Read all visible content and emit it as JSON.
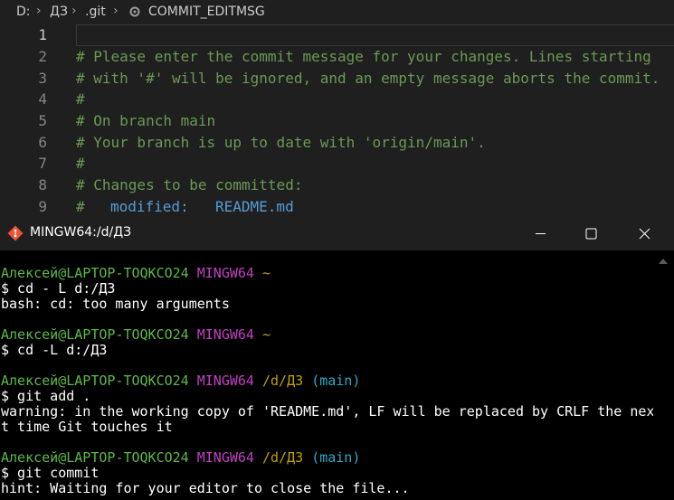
{
  "breadcrumb": {
    "drive": "D:",
    "folder1": "ДЗ",
    "folder2": ".git",
    "file": "COMMIT_EDITMSG"
  },
  "editor": {
    "lines": [
      {
        "num": "1",
        "text": ""
      },
      {
        "num": "2",
        "text": "# Please enter the commit message for your changes. Lines starting"
      },
      {
        "num": "3",
        "text": "# with '#' will be ignored, and an empty message aborts the commit."
      },
      {
        "num": "4",
        "text": "#"
      },
      {
        "num": "5",
        "text": "# On branch main"
      },
      {
        "num": "6",
        "text": "# Your branch is up to date with 'origin/main'."
      },
      {
        "num": "7",
        "text": "#"
      },
      {
        "num": "8",
        "text": "# Changes to be committed:"
      },
      {
        "num": "9",
        "prefix": "#",
        "label": "modified:",
        "file": "README.md"
      }
    ]
  },
  "terminal": {
    "title": "MINGW64:/d/ДЗ",
    "prompts": [
      {
        "user": "Алексей@LAPTOP-TOQKCO24",
        "env": "MINGW64",
        "path": "~",
        "branch": ""
      },
      {
        "user": "Алексей@LAPTOP-TOQKCO24",
        "env": "MINGW64",
        "path": "~",
        "branch": ""
      },
      {
        "user": "Алексей@LAPTOP-TOQKCO24",
        "env": "MINGW64",
        "path": "/d/ДЗ",
        "branch": "(main)"
      },
      {
        "user": "Алексей@LAPTOP-TOQKCO24",
        "env": "MINGW64",
        "path": "/d/ДЗ",
        "branch": "(main)"
      }
    ],
    "commands": [
      "$ cd - L d:/ДЗ",
      "$ cd -L d:/ДЗ",
      "$ git add .",
      "$ git commit"
    ],
    "outputs": {
      "cd_error": "bash: cd: too many arguments",
      "warning_1": "warning: in the working copy of 'README.md', LF will be replaced by CRLF the nex",
      "warning_2": "t time Git touches it",
      "hint": "hint: Waiting for your editor to close the file..."
    }
  }
}
